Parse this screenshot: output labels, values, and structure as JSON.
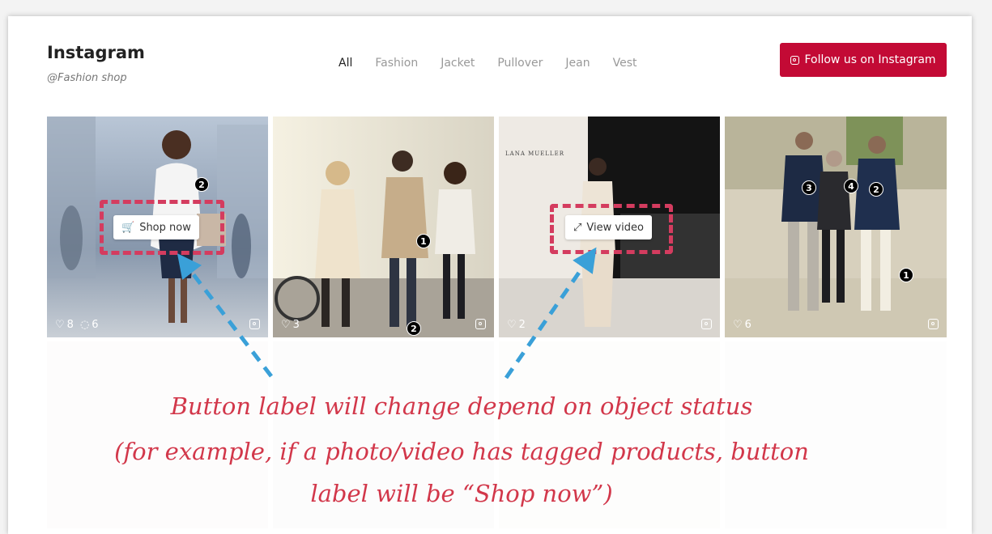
{
  "header": {
    "title": "Instagram",
    "subtitle": "@Fashion shop",
    "follow_label": "Follow us on Instagram"
  },
  "filters": [
    "All",
    "Fashion",
    "Jacket",
    "Pullover",
    "Jean",
    "Vest"
  ],
  "tiles": [
    {
      "likes": "8",
      "comments": "6",
      "button": "Shop now"
    },
    {
      "likes": "3"
    },
    {
      "likes": "2",
      "button": "View video",
      "runway_text": "LANA MUELLER"
    },
    {
      "likes": "6"
    }
  ],
  "tags": {
    "tile1": [
      "2"
    ],
    "tile2": [
      "1",
      "2"
    ],
    "tile4": [
      "3",
      "4",
      "2",
      "1"
    ]
  },
  "annotation": {
    "line1": "Button label will change depend on object status",
    "line2": "(for example, if a photo/video has tagged products, button",
    "line3": "label will be “Shop now”)"
  },
  "colors": {
    "accent": "#c30a35",
    "annotation": "#d2374a",
    "arrow": "#3aa0d8"
  }
}
